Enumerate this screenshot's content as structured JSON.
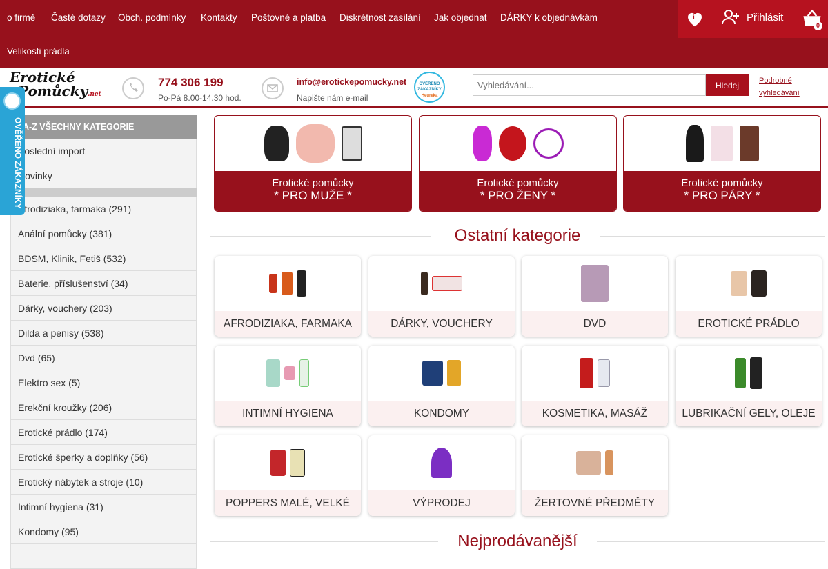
{
  "topnav": {
    "links": [
      "o firmě",
      "Časté dotazy",
      "Obch. podmínky",
      "Kontakty",
      "Poštovné a platba",
      "Diskrétnost zasílání",
      "Jak objednat",
      "DÁRKY k objednávkám",
      "Velikosti prádla"
    ]
  },
  "actions": {
    "wishlist_count": "i",
    "login_label": "Přihlásit",
    "cart_count": "0"
  },
  "header": {
    "logo_line1": "Erotické",
    "logo_line2": "Pomůcky",
    "logo_suffix": ".net",
    "phone": "774 306 199",
    "phone_hours": "Po-Pá 8.00-14.30 hod.",
    "email": "info@erotickepomucky.net",
    "email_note": "Napište nám e-mail",
    "badge_top": "OVĚŘENO",
    "badge_mid": "ZÁKAZNÍKY",
    "badge_bottom": "Heureka",
    "search_placeholder": "Vyhledávání...",
    "search_button": "Hledej",
    "advanced_search": "Podrobné vyhledávání"
  },
  "overeno_badge": "OVĚŘENO ZÁKAZNÍKY",
  "sidebar": {
    "header": "A-Z VŠECHNY KATEGORIE",
    "top_items": [
      "Poslední import",
      "Novinky"
    ],
    "items": [
      "Afrodiziaka, farmaka (291)",
      "Anální pomůcky (381)",
      "BDSM, Klinik, Fetiš (532)",
      "Baterie, příslušenství (34)",
      "Dárky, vouchery (203)",
      "Dilda a penisy (538)",
      "Dvd (65)",
      "Elektro sex (5)",
      "Erekční kroužky (206)",
      "Erotické prádlo (174)",
      "Erotické šperky a doplňky (56)",
      "Erotický nábytek a stroje (10)",
      "Intimní hygiena (31)",
      "Kondomy (95)"
    ]
  },
  "big_cards": [
    {
      "line1": "Erotické pomůcky",
      "line2": "* PRO MUŽE *"
    },
    {
      "line1": "Erotické pomůcky",
      "line2": "* PRO ŽENY *"
    },
    {
      "line1": "Erotické pomůcky",
      "line2": "* PRO PÁRY *"
    }
  ],
  "sections": {
    "other": "Ostatní kategorie",
    "bestsellers": "Nejprodávanější"
  },
  "categories": [
    "AFRODIZIAKA, FARMAKA",
    "DÁRKY, VOUCHERY",
    "DVD",
    "EROTICKÉ PRÁDLO",
    "INTIMNÍ HYGIENA",
    "KONDOMY",
    "KOSMETIKA, MASÁŽ",
    "LUBRIKAČNÍ GELY, OLEJE",
    "POPPERS MALÉ, VELKÉ",
    "VÝPRODEJ",
    "ŽERTOVNÉ PŘEDMĚTY"
  ],
  "colors": {
    "brand_red": "#97111c",
    "accent_red": "#b6121f",
    "badge_blue": "#2aa4d6"
  }
}
